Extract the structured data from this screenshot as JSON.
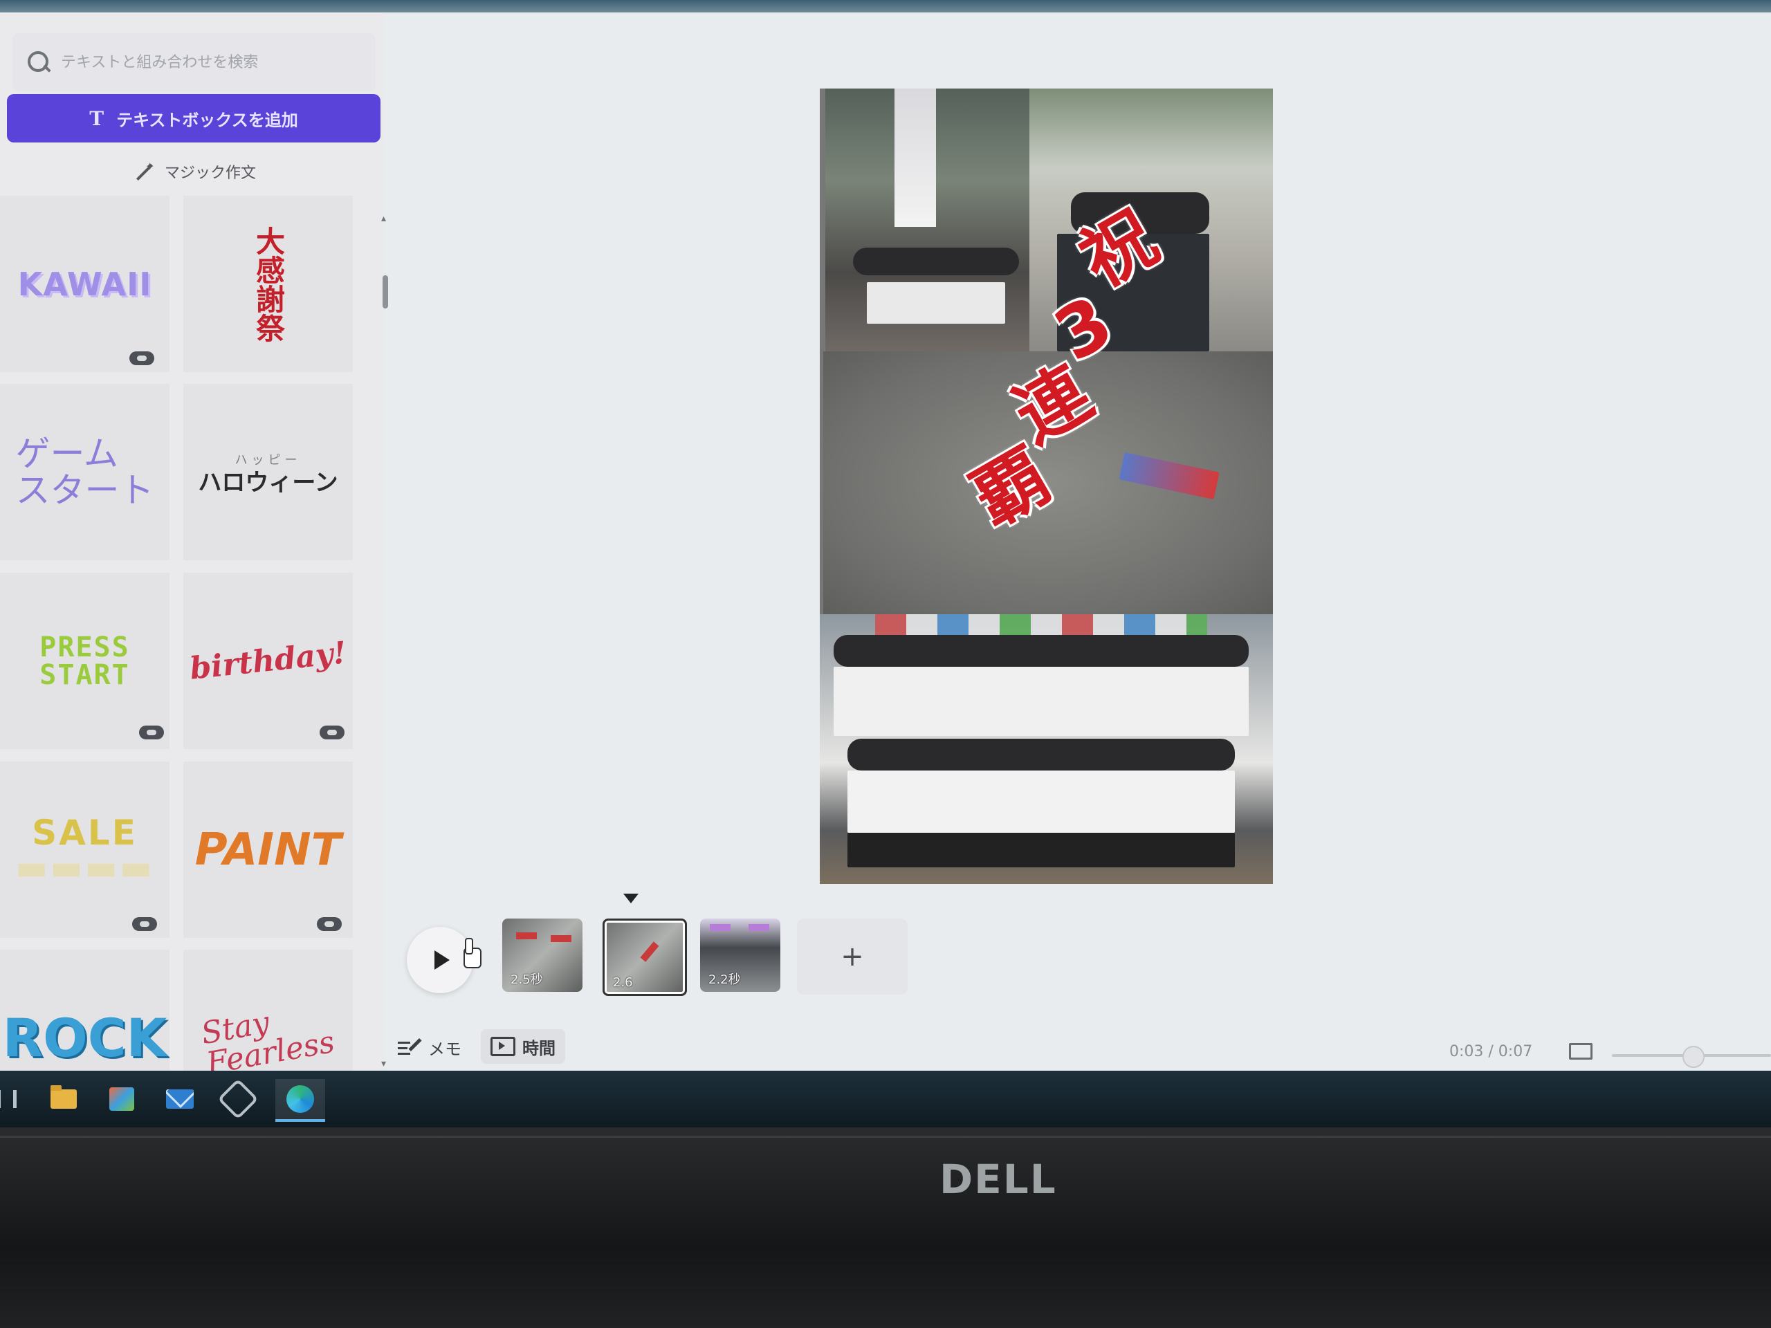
{
  "panel": {
    "search_placeholder": "テキストと組み合わせを検索",
    "add_textbox_label": "テキストボックスを追加",
    "add_textbox_icon": "T",
    "magic_text_label": "マジック作文",
    "styles": [
      {
        "text": "KAWAII",
        "color": "#9f8fe6"
      },
      {
        "text": "大感謝祭",
        "color": "#c4202a"
      },
      {
        "text": "ゲーム\nスタート",
        "color": "#8c7ed8"
      },
      {
        "ruby": "ハッピー",
        "text": "ハロウィーン",
        "color": "#2b2b2b"
      },
      {
        "text": "PRESS\nSTART",
        "color": "#9acb3c"
      },
      {
        "text": "birthday!",
        "color": "#c8334a"
      },
      {
        "text": "SALE",
        "color": "#d9c24a"
      },
      {
        "text": "PAINT",
        "color": "#e07a28"
      },
      {
        "text": "ROCK",
        "color": "#3a9fd4"
      },
      {
        "text": "Stay\nFearless",
        "color": "#c23a53"
      }
    ]
  },
  "poster": {
    "celebration_chars": [
      "祝",
      "3",
      "連",
      "覇"
    ],
    "celebration_color": "#d11a22"
  },
  "timeline": {
    "clips": [
      {
        "duration": "2.5秒",
        "selected": false
      },
      {
        "duration": "2.6",
        "selected": true
      },
      {
        "duration": "2.2秒",
        "selected": false
      }
    ],
    "add_clip_label": "+",
    "memo_label": "メモ",
    "time_label": "時間",
    "time_readout": "0:03 / 0:07"
  },
  "monitor": {
    "brand": "DELL"
  },
  "taskbar": {
    "items": [
      "task-view-icon",
      "file-explorer-icon",
      "store-icon",
      "mail-icon",
      "settings-icon",
      "edge-browser-icon"
    ],
    "active": "edge-browser-icon"
  },
  "colors": {
    "accent": "#5a43d9",
    "canvas_bg": "#e9ecee",
    "panel_bg": "#eaeaed"
  }
}
